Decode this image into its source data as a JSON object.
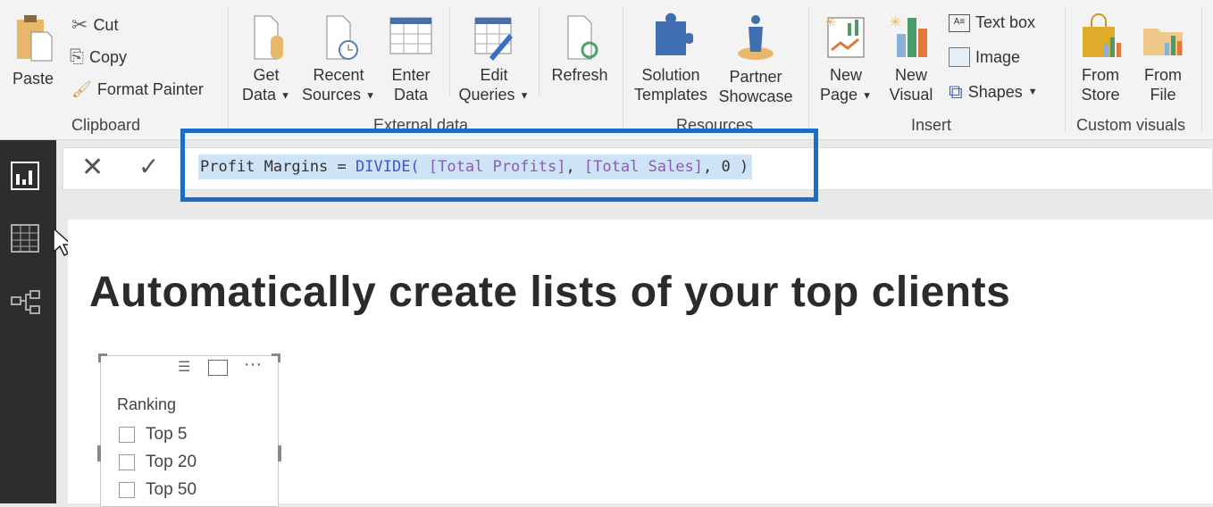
{
  "ribbon": {
    "clipboard": {
      "paste": "Paste",
      "cut": "Cut",
      "copy": "Copy",
      "format_painter": "Format Painter",
      "group": "Clipboard"
    },
    "external_data": {
      "get_data": [
        "Get",
        "Data"
      ],
      "recent_sources": [
        "Recent",
        "Sources"
      ],
      "enter_data": [
        "Enter",
        "Data"
      ],
      "edit_queries": [
        "Edit",
        "Queries"
      ],
      "refresh": "Refresh",
      "group": "External data"
    },
    "resources": {
      "solution_templates": [
        "Solution",
        "Templates"
      ],
      "partner_showcase": [
        "Partner",
        "Showcase"
      ],
      "group": "Resources"
    },
    "insert": {
      "new_page": [
        "New",
        "Page"
      ],
      "new_visual": [
        "New",
        "Visual"
      ],
      "text_box": "Text box",
      "image": "Image",
      "shapes": "Shapes",
      "group": "Insert"
    },
    "custom_visuals": {
      "from_store": [
        "From",
        "Store"
      ],
      "from_file": [
        "From",
        "File"
      ],
      "group": "Custom visuals"
    }
  },
  "formula": {
    "name": "Profit Margins",
    "eq": " = ",
    "fn": "DIVIDE(",
    "arg1": " [Total Profits]",
    "c1": ",",
    "arg2": " [Total Sales]",
    "rest": ", 0 )",
    "cancel_icon": "x-icon",
    "commit_icon": "check-icon"
  },
  "sidebar": {
    "items": [
      "report-icon",
      "data-icon",
      "relationships-icon"
    ]
  },
  "canvas": {
    "title": "Automatically create lists of your top clients"
  },
  "slicer": {
    "header": "Ranking",
    "options": [
      "Top 5",
      "Top 20",
      "Top 50"
    ]
  },
  "colors": {
    "highlight_border": "#1b6ec2",
    "selection": "#cfe3f7",
    "sidebar": "#2d2d2d"
  }
}
